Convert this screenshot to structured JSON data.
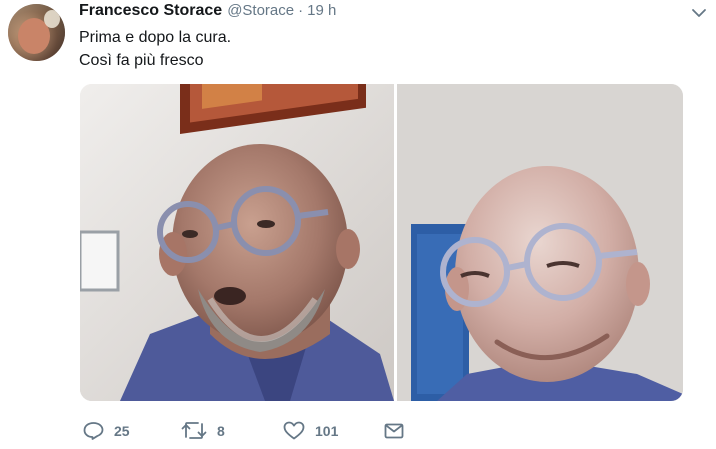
{
  "tweet": {
    "author_name": "Francesco Storace",
    "handle": "@Storace",
    "separator": "·",
    "time": "19 h",
    "lines": [
      "Prima e dopo la cura.",
      "Così fa più fresco"
    ]
  },
  "actions": {
    "replies": "25",
    "retweets": "8",
    "likes": "101"
  },
  "colors": {
    "text": "#14171a",
    "secondary": "#657786",
    "background": "#ffffff"
  },
  "icons": [
    "chevron-down-icon",
    "reply-icon",
    "retweet-icon",
    "like-icon",
    "direct-message-icon"
  ]
}
